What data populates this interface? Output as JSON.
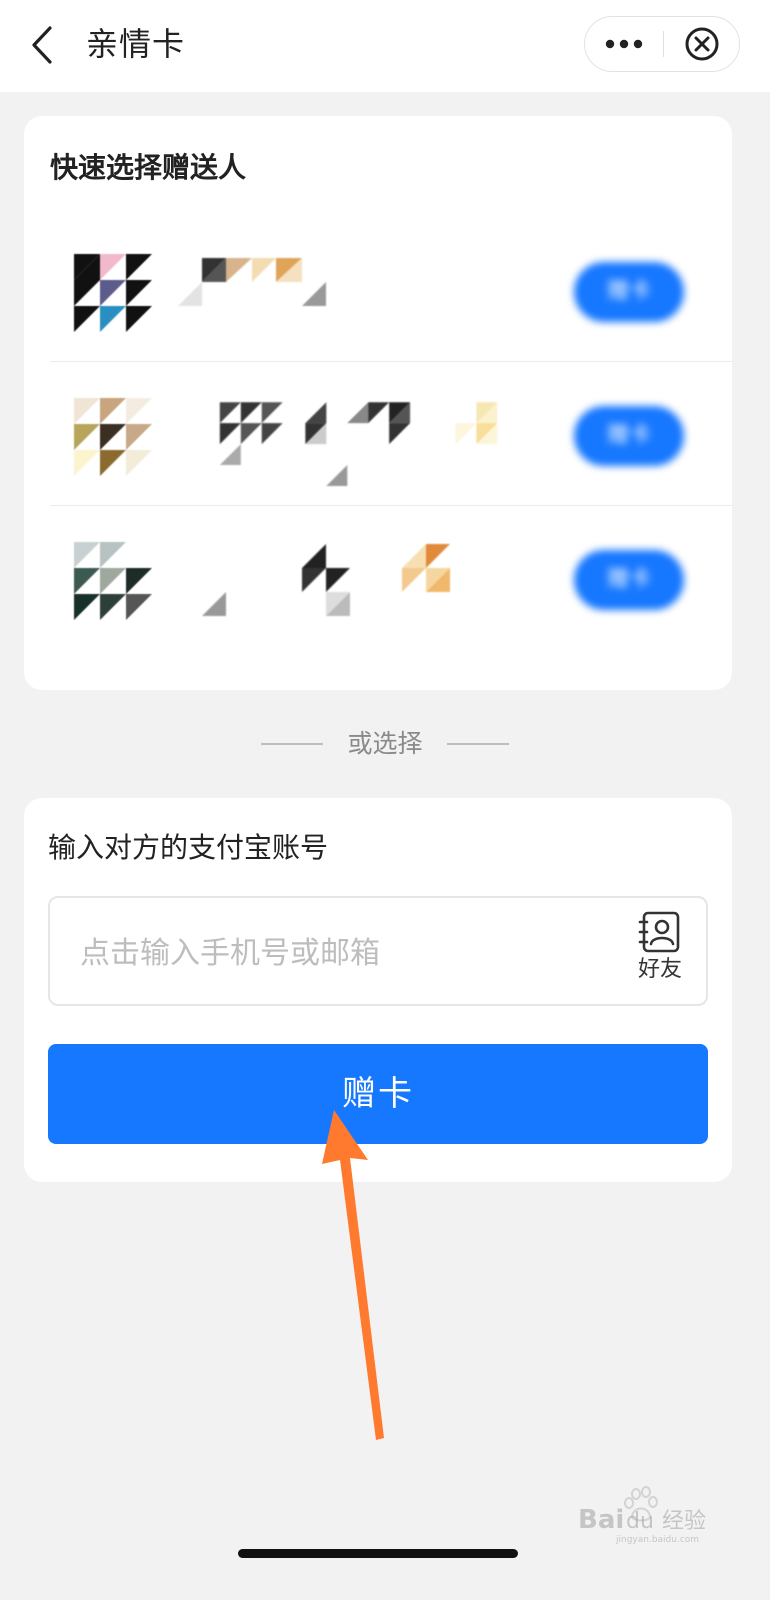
{
  "header": {
    "title": "亲情卡",
    "back_icon": "chevron-left-icon",
    "more_icon": "more-dots-icon",
    "close_icon": "close-circle-icon"
  },
  "quick_select": {
    "title": "快速选择赠送人",
    "recipients": [
      {
        "button_label": "赠卡"
      },
      {
        "button_label": "赠卡"
      },
      {
        "button_label": "赠卡"
      }
    ]
  },
  "or_choose": {
    "text": "或选择"
  },
  "account_input": {
    "label": "输入对方的支付宝账号",
    "placeholder": "点击输入手机号或邮箱",
    "value": "",
    "friend_icon": "contacts-icon",
    "friend_label": "好友"
  },
  "primary_button": {
    "label": "赠卡"
  },
  "watermark": {
    "text": "Baidu经验",
    "subtext": "jingyan.baidu.com"
  },
  "colors": {
    "accent": "#1677ff",
    "background": "#f2f2f2",
    "annotation_arrow": "#ff7a2f"
  }
}
